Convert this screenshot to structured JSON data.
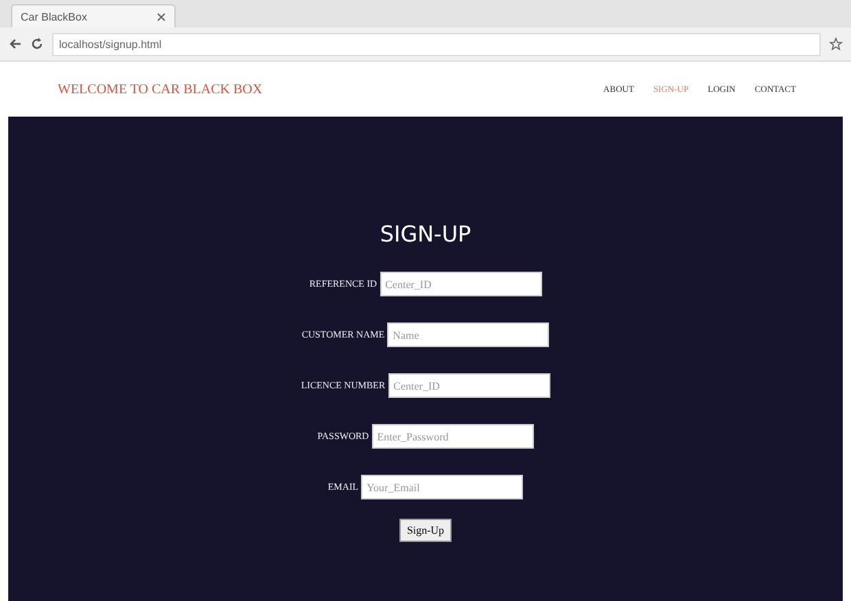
{
  "browser": {
    "tab_title": "Car BlackBox",
    "address": "localhost/signup.html"
  },
  "header": {
    "brand": "WELCOME TO CAR BLACK BOX",
    "nav": [
      {
        "label": "ABOUT",
        "selected": false
      },
      {
        "label": "SIGN-UP",
        "selected": true
      },
      {
        "label": "LOGIN",
        "selected": false
      },
      {
        "label": "CONTACT",
        "selected": false
      }
    ]
  },
  "form": {
    "title": "SIGN-UP",
    "fields": [
      {
        "label": "REFERENCE ID",
        "placeholder": "Center_ID"
      },
      {
        "label": "CUSTOMER NAME",
        "placeholder": "Name"
      },
      {
        "label": "LICENCE NUMBER",
        "placeholder": "Center_ID"
      },
      {
        "label": "PASSWORD",
        "placeholder": "Enter_Password"
      },
      {
        "label": "EMAIL",
        "placeholder": "Your_Email"
      }
    ],
    "submit": "Sign-Up"
  }
}
